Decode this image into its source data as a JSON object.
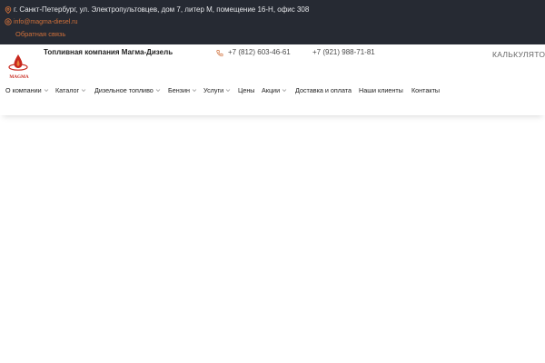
{
  "topbar": {
    "address": "г. Санкт-Петербург, ул. Электропультовцев, дом 7, литер М, помещение 16-Н, офис 308",
    "email": "info@magma-diesel.ru",
    "feedback": "Обратная связь"
  },
  "header": {
    "logo_text": "MAGMA",
    "company_name": "Топливная компания Магма-Дизель",
    "phone1": "+7 (812) 603-46-61",
    "phone2": "+7 (921) 988-71-81",
    "calculator": "КАЛЬКУЛЯТОР"
  },
  "nav": {
    "items": [
      {
        "label": "О компании",
        "dropdown": true
      },
      {
        "label": "Каталог",
        "dropdown": true
      },
      {
        "label": "Дизельное топливо",
        "dropdown": true
      },
      {
        "label": "Бензин",
        "dropdown": true
      },
      {
        "label": "Услуги",
        "dropdown": true
      },
      {
        "label": "Цены",
        "dropdown": false
      },
      {
        "label": "Акции",
        "dropdown": true
      },
      {
        "label": "Доставка и оплата",
        "dropdown": false
      },
      {
        "label": "Наши клиенты",
        "dropdown": false
      },
      {
        "label": "Контакты",
        "dropdown": false
      }
    ]
  },
  "colors": {
    "topbar_bg": "#262a33",
    "accent": "#d0703a",
    "logo_red": "#c8281e"
  }
}
